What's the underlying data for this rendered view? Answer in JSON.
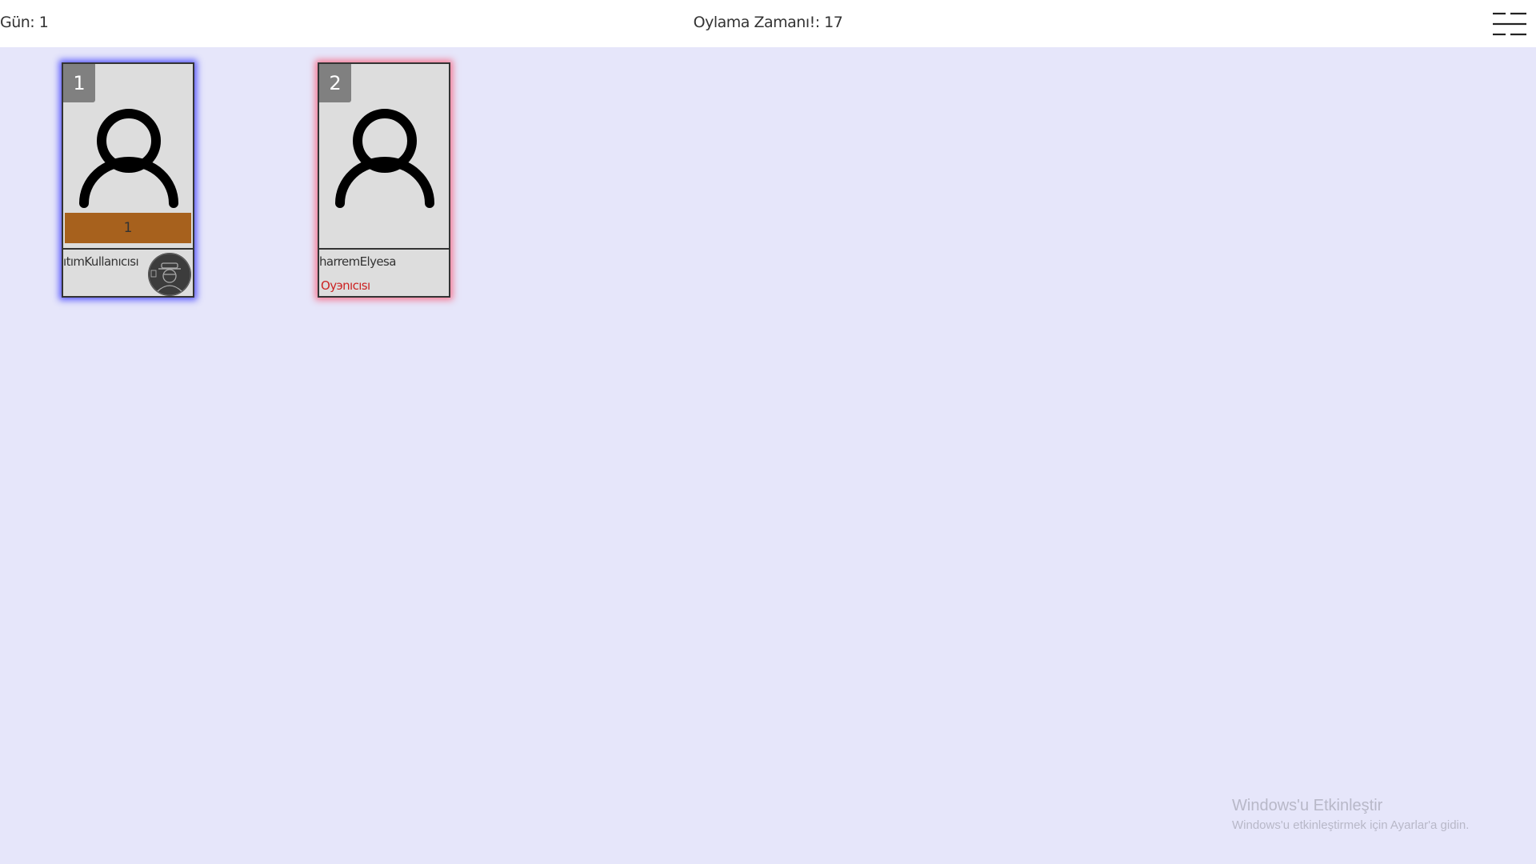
{
  "header": {
    "day_label": "Gün: 1",
    "timer_label": "Oylama Zamanı!: 17",
    "menu_icon": "menu-icon"
  },
  "players": [
    {
      "slot": "1",
      "name": "ıtımKullanıcısı",
      "votes": "1",
      "highlight": "blue",
      "has_role_avatar": true
    },
    {
      "slot": "2",
      "name": "harremElyesa",
      "role": "Oyэnıcısı",
      "highlight": "red"
    }
  ],
  "colors": {
    "background": "#e6e6fa",
    "vote_bar": "#a7611d",
    "role_text": "#cc2222"
  },
  "watermark": {
    "title": "Windows'u Etkinleştir",
    "subtitle": "Windows'u etkinleştirmek için Ayarlar'a gidin."
  }
}
